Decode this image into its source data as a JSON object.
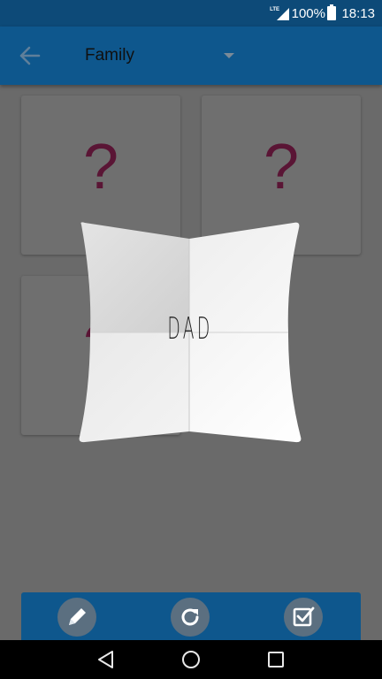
{
  "status_bar": {
    "network_label": "LTE",
    "battery_percent": "100%",
    "time": "18:13",
    "icons": [
      "signal-icon",
      "battery-icon"
    ]
  },
  "app_bar": {
    "title": "Family",
    "icons": [
      "back-arrow-icon",
      "dropdown-arrow-icon"
    ]
  },
  "cards": [
    {
      "label": "?"
    },
    {
      "label": "?"
    },
    {
      "label": "?"
    }
  ],
  "folded_card": {
    "word": "DAD"
  },
  "bottom_bar": {
    "buttons": [
      {
        "icon": "pencil-icon"
      },
      {
        "icon": "refresh-icon"
      },
      {
        "icon": "checkbox-icon"
      }
    ]
  },
  "nav_bar": {
    "icons": [
      "back-triangle-icon",
      "home-circle-icon",
      "recents-square-icon"
    ]
  },
  "colors": {
    "status_bar": "#0d4a78",
    "app_bar": "#0e578d",
    "dim_background": "#6a6a6a",
    "question_mark": "#5a1535",
    "button_fill": "#5b6f80"
  }
}
